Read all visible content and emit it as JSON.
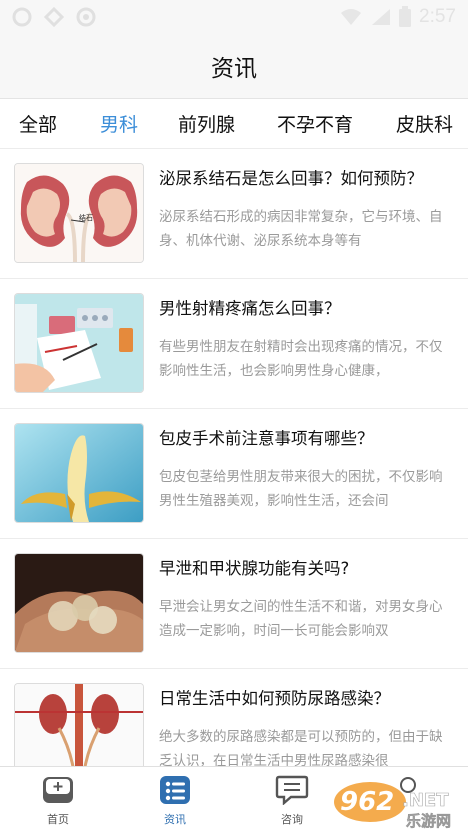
{
  "status_bar": {
    "time": "2:57"
  },
  "header": {
    "title": "资讯"
  },
  "tabs": [
    {
      "label": "全部"
    },
    {
      "label": "男科"
    },
    {
      "label": "前列腺"
    },
    {
      "label": "不孕不育"
    },
    {
      "label": "皮肤科"
    }
  ],
  "active_tab": "男科",
  "articles": [
    {
      "title": "泌尿系结石是怎么回事？如何预防？",
      "summary": "泌尿系结石形成的病因非常复杂，它与环境、自身、机体代谢、泌尿系统本身等有",
      "image_label": "结石"
    },
    {
      "title": "男性射精疼痛怎么回事？",
      "summary": "有些男性朋友在射精时会出现疼痛的情况，不仅影响性生活，也会影响男性身心健康，"
    },
    {
      "title": "包皮手术前注意事项有哪些？",
      "summary": "包皮包茎给男性朋友带来很大的困扰，不仅影响男性生殖器美观，影响性生活，还会间"
    },
    {
      "title": "早泄和甲状腺功能有关吗?",
      "summary": "早泄会让男女之间的性生活不和谐，对男女身心造成一定影响，时间一长可能会影响双"
    },
    {
      "title": "日常生活中如何预防尿路感染？",
      "summary": "绝大多数的尿路感染都是可以预防的，但由于缺乏认识，在日常生活中男性尿路感染很"
    }
  ],
  "bottom_nav": [
    {
      "label": "首页"
    },
    {
      "label": "资讯"
    },
    {
      "label": "咨询"
    }
  ],
  "watermark": {
    "brand": "962",
    "suffix": ".NET",
    "sub": "乐游网"
  },
  "colors": {
    "accent": "#3c8ed8",
    "header_bg": "#f7f7f7",
    "text_gray": "#9a9a9a"
  }
}
